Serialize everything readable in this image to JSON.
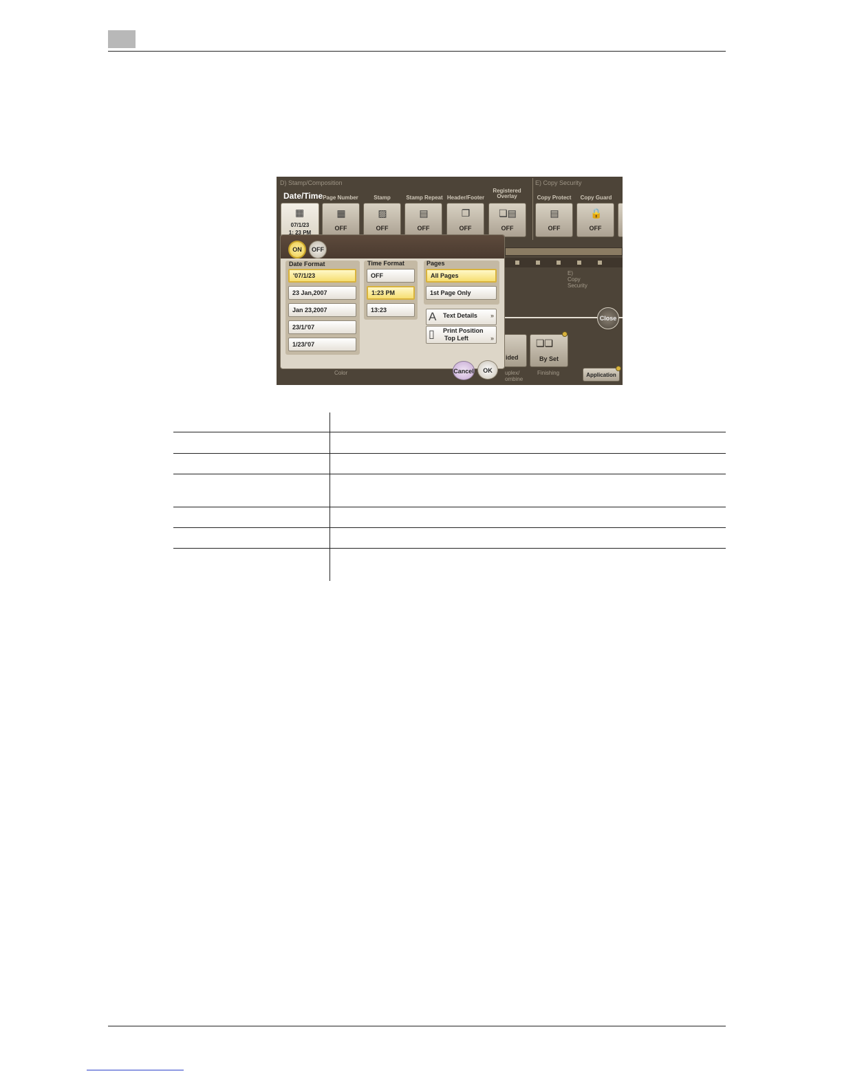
{
  "panel": {
    "section_d": "D)   Stamp/Composition",
    "section_e": "E)   Copy Security",
    "datetime_title": "Date/Time",
    "columns": [
      {
        "label": "Page Number",
        "value": "OFF",
        "icon": "page-number-icon"
      },
      {
        "label": "Stamp",
        "value": "OFF",
        "icon": "stamp-icon"
      },
      {
        "label": "Stamp Repeat",
        "value": "OFF",
        "icon": "stamp-repeat-icon"
      },
      {
        "label": "Header/Footer",
        "value": "OFF",
        "icon": "header-footer-icon"
      },
      {
        "label": "Registered Overlay",
        "value": "OFF",
        "icon": "overlay-icon"
      },
      {
        "label": "Copy Protect",
        "value": "OFF",
        "icon": "copy-protect-icon"
      },
      {
        "label": "Copy Guard",
        "value": "OFF",
        "icon": "copy-guard-icon"
      }
    ],
    "datetime_tile": {
      "line1": "07/1/23",
      "line2": "1: 23 PM"
    },
    "dialog": {
      "on_label": "ON",
      "off_label": "OFF",
      "date_format": {
        "title": "Date Format",
        "options": [
          "'07/1/23",
          "23 Jan,2007",
          "Jan 23,2007",
          "23/1/'07",
          "1/23/'07"
        ],
        "selected": "'07/1/23"
      },
      "time_format": {
        "title": "Time Format",
        "options": [
          "OFF",
          "1:23 PM",
          "13:23"
        ],
        "selected": "1:23 PM"
      },
      "pages": {
        "title": "Pages",
        "options": [
          "All Pages",
          "1st Page Only"
        ],
        "selected": "All Pages"
      },
      "text_details": "Text Details",
      "print_position": {
        "line1": "Print Position",
        "line2": "Top Left"
      },
      "cancel": "Cancel",
      "ok": "OK"
    },
    "background": {
      "close": "Close",
      "copy_security_label": "E)\nCopy\nSecurity",
      "sided_tile": "ided",
      "by_set_tile": "By Set",
      "color_label": "Color",
      "duplex_label": "uplex/\nombine",
      "finishing_label": "Finishing",
      "application": "Application"
    }
  }
}
